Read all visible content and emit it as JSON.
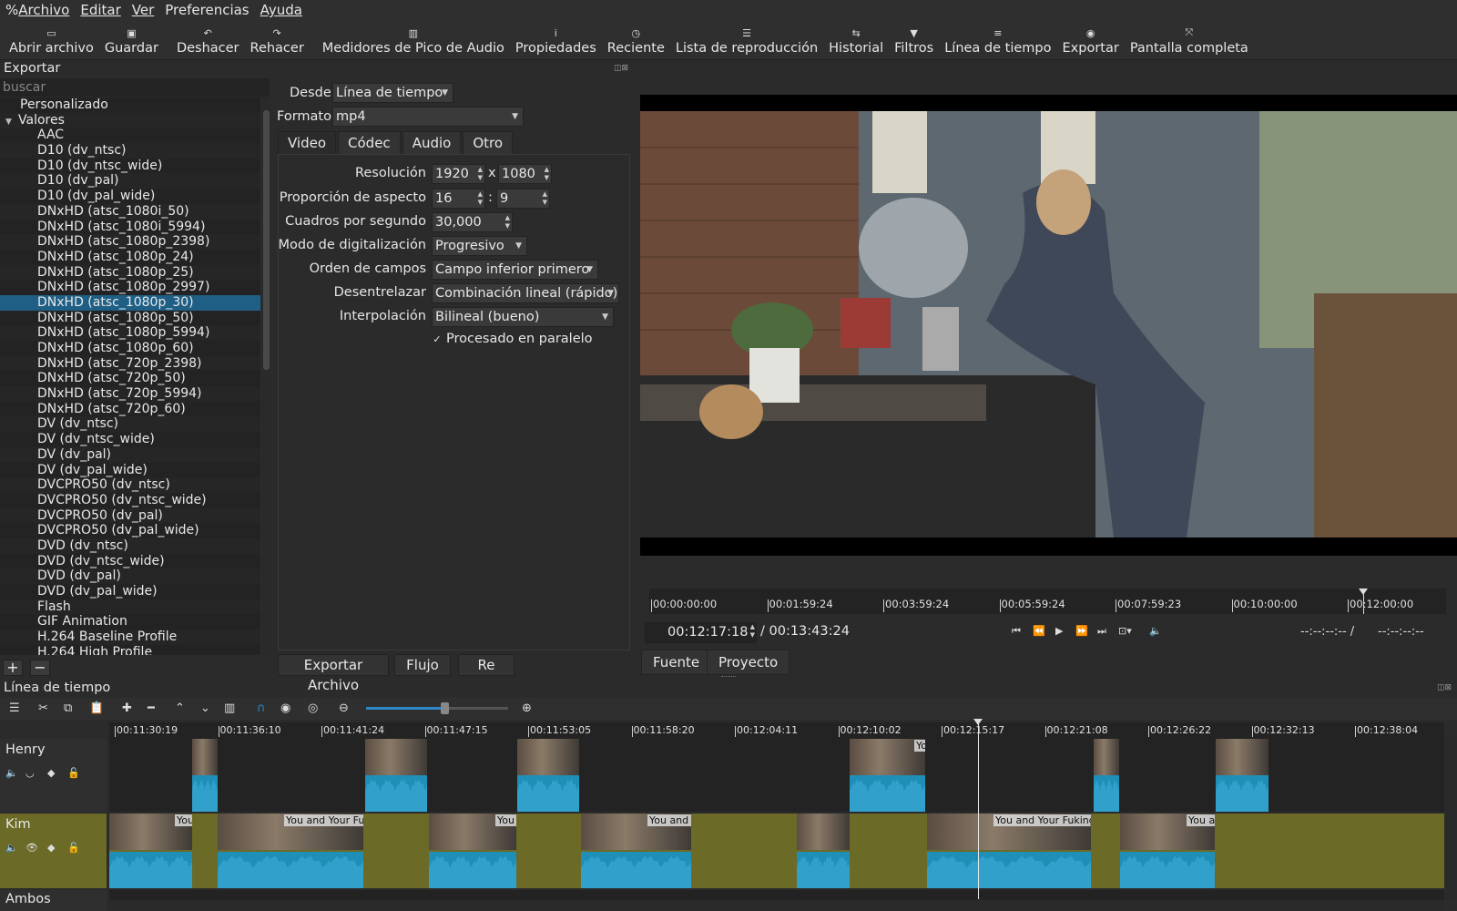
{
  "menu": [
    {
      "accel": "%",
      "label": "Archivo",
      "underline": "A"
    },
    {
      "label": "Editar"
    },
    {
      "label": "Ver"
    },
    {
      "label": "Preferencias"
    },
    {
      "label": "Ayuda"
    }
  ],
  "toolbar": {
    "open": "Abrir archivo",
    "save": "Guardar",
    "undo": "Deshacer",
    "redo": "Rehacer",
    "peak_meter": "Medidores de Pico de Audio",
    "properties": "Propiedades",
    "recent": "Reciente",
    "playlist": "Lista de reproducción",
    "history": "Historial",
    "filters": "Filtros",
    "timeline": "Línea de tiempo",
    "export": "Exportar",
    "fullscreen": "Pantalla completa"
  },
  "export_panel": {
    "title": "Exportar",
    "search_placeholder": "buscar",
    "presets": [
      {
        "label": "Personalizado",
        "level": 0
      },
      {
        "label": "Valores",
        "level": -1,
        "expanded": true
      },
      {
        "label": "AAC",
        "level": 1
      },
      {
        "label": "D10 (dv_ntsc)",
        "level": 1
      },
      {
        "label": "D10 (dv_ntsc_wide)",
        "level": 1
      },
      {
        "label": "D10 (dv_pal)",
        "level": 1
      },
      {
        "label": "D10 (dv_pal_wide)",
        "level": 1
      },
      {
        "label": "DNxHD (atsc_1080i_50)",
        "level": 1
      },
      {
        "label": "DNxHD (atsc_1080i_5994)",
        "level": 1
      },
      {
        "label": "DNxHD (atsc_1080p_2398)",
        "level": 1
      },
      {
        "label": "DNxHD (atsc_1080p_24)",
        "level": 1
      },
      {
        "label": "DNxHD (atsc_1080p_25)",
        "level": 1
      },
      {
        "label": "DNxHD (atsc_1080p_2997)",
        "level": 1
      },
      {
        "label": "DNxHD (atsc_1080p_30)",
        "level": 1,
        "selected": true
      },
      {
        "label": "DNxHD (atsc_1080p_50)",
        "level": 1
      },
      {
        "label": "DNxHD (atsc_1080p_5994)",
        "level": 1
      },
      {
        "label": "DNxHD (atsc_1080p_60)",
        "level": 1
      },
      {
        "label": "DNxHD (atsc_720p_2398)",
        "level": 1
      },
      {
        "label": "DNxHD (atsc_720p_50)",
        "level": 1
      },
      {
        "label": "DNxHD (atsc_720p_5994)",
        "level": 1
      },
      {
        "label": "DNxHD (atsc_720p_60)",
        "level": 1
      },
      {
        "label": "DV (dv_ntsc)",
        "level": 1
      },
      {
        "label": "DV (dv_ntsc_wide)",
        "level": 1
      },
      {
        "label": "DV (dv_pal)",
        "level": 1
      },
      {
        "label": "DV (dv_pal_wide)",
        "level": 1
      },
      {
        "label": "DVCPRO50 (dv_ntsc)",
        "level": 1
      },
      {
        "label": "DVCPRO50 (dv_ntsc_wide)",
        "level": 1
      },
      {
        "label": "DVCPRO50 (dv_pal)",
        "level": 1
      },
      {
        "label": "DVCPRO50 (dv_pal_wide)",
        "level": 1
      },
      {
        "label": "DVD (dv_ntsc)",
        "level": 1
      },
      {
        "label": "DVD (dv_ntsc_wide)",
        "level": 1
      },
      {
        "label": "DVD (dv_pal)",
        "level": 1
      },
      {
        "label": "DVD (dv_pal_wide)",
        "level": 1
      },
      {
        "label": "Flash",
        "level": 1
      },
      {
        "label": "GIF Animation",
        "level": 1
      },
      {
        "label": "H.264 Baseline Profile",
        "level": 1
      },
      {
        "label": "H.264 High Profile",
        "level": 1
      }
    ],
    "add_label": "+",
    "remove_label": "−"
  },
  "settings": {
    "from_label": "Desde",
    "from_value": "Línea de tiempo",
    "format_label": "Formato",
    "format_value": "mp4",
    "tabs": [
      "Video",
      "Códec",
      "Audio",
      "Otro"
    ],
    "active_tab": "Video",
    "resolution_label": "Resolución",
    "res_w": "1920",
    "res_x": "x",
    "res_h": "1080",
    "aspect_label": "Proporción de aspecto",
    "aspect_w": "16",
    "aspect_sep": ":",
    "aspect_h": "9",
    "fps_label": "Cuadros por segundo",
    "fps_value": "30,000",
    "scan_label": "Modo de digitalización",
    "scan_value": "Progresivo",
    "field_label": "Orden de campos",
    "field_value": "Campo inferior primero",
    "deint_label": "Desentrelazar",
    "deint_value": "Combinación lineal (rápido)",
    "interp_label": "Interpolación",
    "interp_value": "Bilineal (bueno)",
    "parallel_label": "Procesado en paralelo",
    "parallel_checked": true,
    "export_file": "Exportar Archivo",
    "stream": "Flujo",
    "reset": "Re"
  },
  "player": {
    "ruler_ticks": [
      "00:00:00:00",
      "00:01:59:24",
      "00:03:59:24",
      "00:05:59:24",
      "00:07:59:23",
      "00:10:00:00",
      "00:12:00:00"
    ],
    "current_time": "00:12:17:18",
    "total_time": "/ 00:13:43:24",
    "in_point": "--:--:--:-- /",
    "out_point": "--:--:--:--",
    "tab_source": "Fuente",
    "tab_project": "Proyecto"
  },
  "timeline": {
    "title": "Línea de tiempo",
    "ticks": [
      "00:11:30:19",
      "00:11:36:10",
      "00:11:41:24",
      "00:11:47:15",
      "00:11:53:05",
      "00:11:58:20",
      "00:12:04:11",
      "00:12:10:02",
      "00:12:15:17",
      "00:12:21:08",
      "00:12:26:22",
      "00:12:32:13",
      "00:12:38:04"
    ],
    "tracks": [
      {
        "name": "Henry"
      },
      {
        "name": "Kim"
      },
      {
        "name": "Ambos"
      }
    ],
    "clip_labels": [
      "You",
      "You and Your Fuki",
      "You a",
      "You and Y",
      "You and Your Fuking C",
      "You ar",
      "Yo",
      "You and Your Fuking C"
    ]
  },
  "colors": {
    "selection": "#1f5f86",
    "waveform": "#1f8fb8",
    "gap": "#6b6a26",
    "accent": "#2d87c6"
  }
}
